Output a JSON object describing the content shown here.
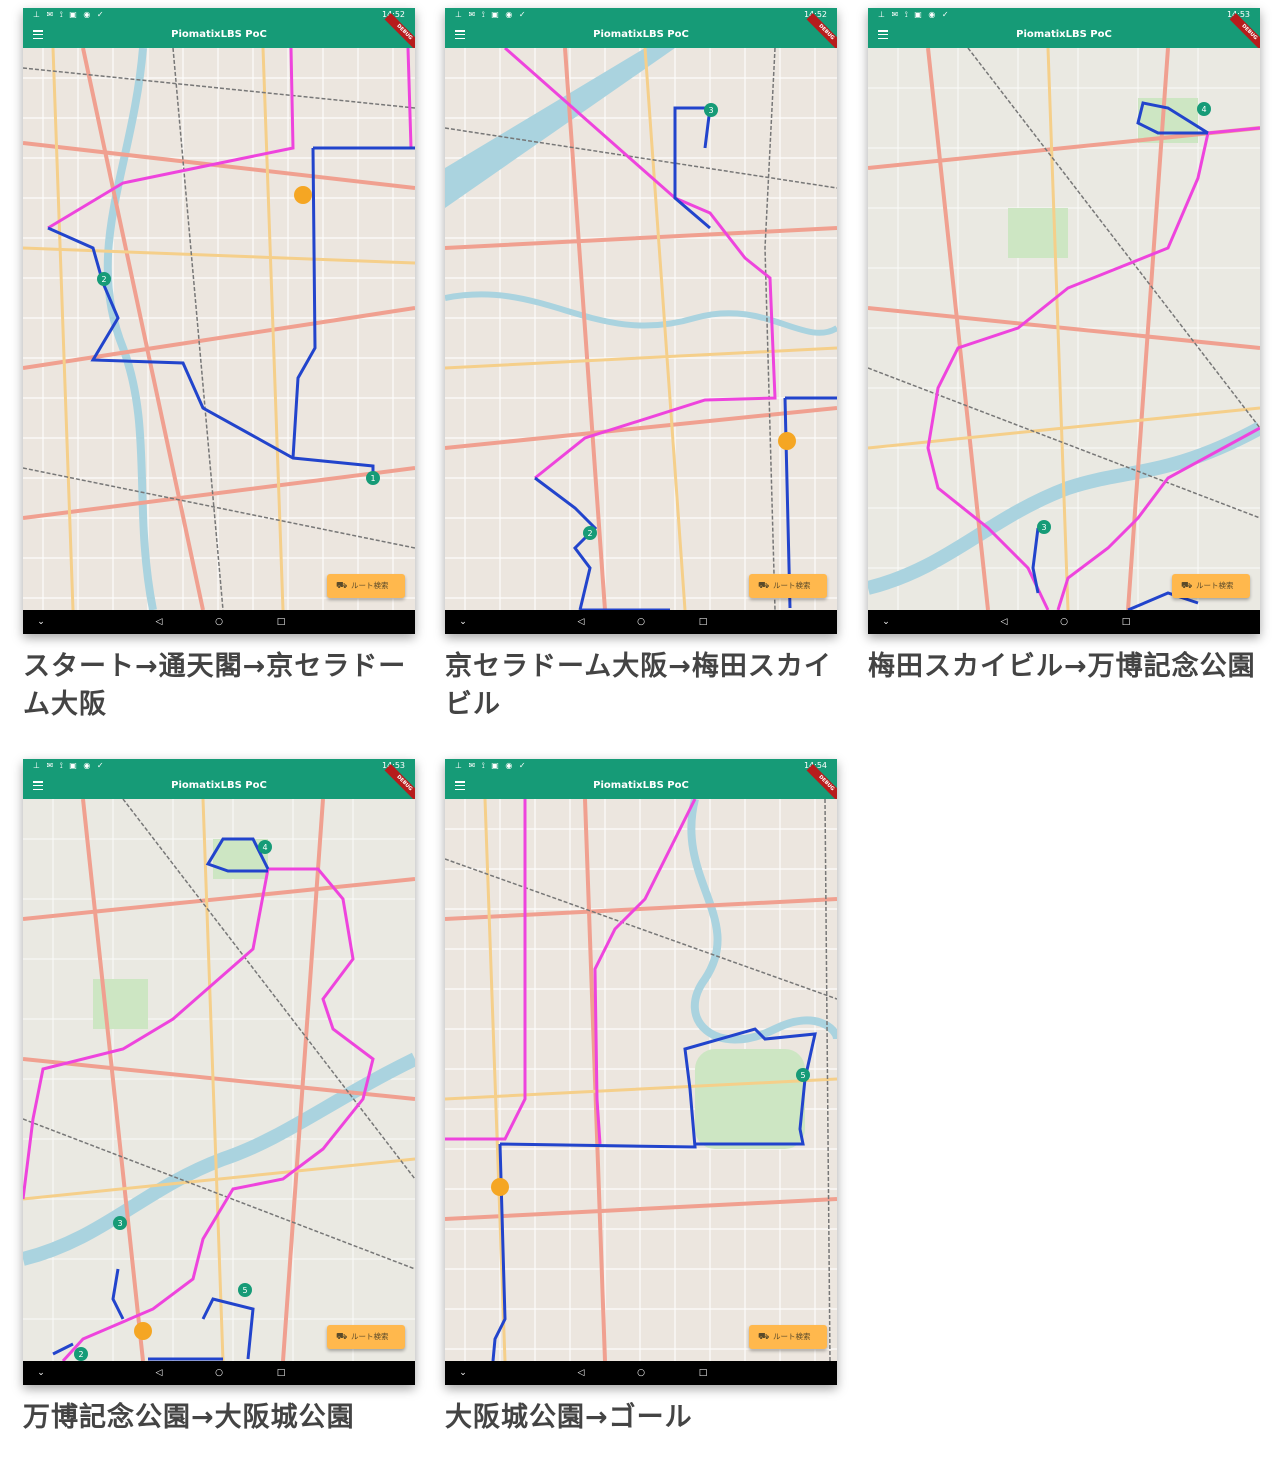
{
  "app": {
    "title": "PiomatixLBS PoC",
    "debug_label": "DEBUG",
    "route_search_label": "ルート検索",
    "status_icons": "⊥ ✉ ⟟ ▣ ◉ ✓"
  },
  "colors": {
    "appbar": "#169b77",
    "route_blue": "#2244cc",
    "route_magenta": "#ee44dd",
    "marker_green": "#169b77",
    "marker_orange": "#f5a623",
    "button_orange": "#ffb84d"
  },
  "screens": [
    {
      "time": "14:52",
      "caption": "スタート→通天閣→京セラドーム大阪",
      "markers": [
        "1",
        "2"
      ]
    },
    {
      "time": "14:52",
      "caption": "京セラドーム大阪→梅田スカイビル",
      "markers": [
        "2",
        "3"
      ]
    },
    {
      "time": "14:53",
      "caption": "梅田スカイビル→万博記念公園",
      "markers": [
        "3",
        "4"
      ]
    },
    {
      "time": "14:53",
      "caption": "万博記念公園→大阪城公園",
      "markers": [
        "4",
        "3",
        "5",
        "2"
      ]
    },
    {
      "time": "14:54",
      "caption": "大阪城公園→ゴール",
      "markers": [
        "5"
      ]
    }
  ]
}
